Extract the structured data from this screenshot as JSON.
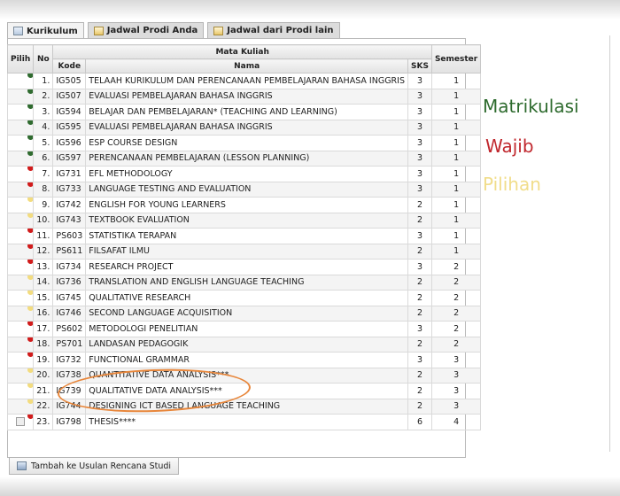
{
  "tabs": [
    {
      "label": "Kurikulum",
      "active": true
    },
    {
      "label": "Jadwal Prodi Anda",
      "active": false
    },
    {
      "label": "Jadwal dari Prodi lain",
      "active": false
    }
  ],
  "table": {
    "headers": {
      "pilih": "Pilih",
      "no": "No",
      "mata_kuliah": "Mata Kuliah",
      "kode": "Kode",
      "nama": "Nama",
      "sks": "SKS",
      "semester": "Semester"
    },
    "rows": [
      {
        "no": "1.",
        "kode": "IG505",
        "nama": "TELAAH KURIKULUM DAN PERENCANAAN PEMBELAJARAN BAHASA INGGRIS",
        "sks": "3",
        "semester": "1",
        "mark": "green"
      },
      {
        "no": "2.",
        "kode": "IG507",
        "nama": "EVALUASI PEMBELAJARAN BAHASA INGGRIS",
        "sks": "3",
        "semester": "1",
        "mark": "green"
      },
      {
        "no": "3.",
        "kode": "IG594",
        "nama": "BELAJAR DAN PEMBELAJARAN* (TEACHING AND LEARNING)",
        "sks": "3",
        "semester": "1",
        "mark": "green"
      },
      {
        "no": "4.",
        "kode": "IG595",
        "nama": "EVALUASI PEMBELAJARAN BAHASA INGGRIS",
        "sks": "3",
        "semester": "1",
        "mark": "green"
      },
      {
        "no": "5.",
        "kode": "IG596",
        "nama": "ESP COURSE DESIGN",
        "sks": "3",
        "semester": "1",
        "mark": "green"
      },
      {
        "no": "6.",
        "kode": "IG597",
        "nama": "PERENCANAAN PEMBELAJARAN (LESSON PLANNING)",
        "sks": "3",
        "semester": "1",
        "mark": "green"
      },
      {
        "no": "7.",
        "kode": "IG731",
        "nama": "EFL METHODOLOGY",
        "sks": "3",
        "semester": "1",
        "mark": "red"
      },
      {
        "no": "8.",
        "kode": "IG733",
        "nama": "LANGUAGE TESTING AND EVALUATION",
        "sks": "3",
        "semester": "1",
        "mark": "red"
      },
      {
        "no": "9.",
        "kode": "IG742",
        "nama": "ENGLISH FOR YOUNG LEARNERS",
        "sks": "2",
        "semester": "1",
        "mark": "yellow"
      },
      {
        "no": "10.",
        "kode": "IG743",
        "nama": "TEXTBOOK EVALUATION",
        "sks": "2",
        "semester": "1",
        "mark": "yellow"
      },
      {
        "no": "11.",
        "kode": "PS603",
        "nama": "STATISTIKA TERAPAN",
        "sks": "3",
        "semester": "1",
        "mark": "red"
      },
      {
        "no": "12.",
        "kode": "PS611",
        "nama": "FILSAFAT ILMU",
        "sks": "2",
        "semester": "1",
        "mark": "red"
      },
      {
        "no": "13.",
        "kode": "IG734",
        "nama": "RESEARCH PROJECT",
        "sks": "3",
        "semester": "2",
        "mark": "red"
      },
      {
        "no": "14.",
        "kode": "IG736",
        "nama": "TRANSLATION AND ENGLISH LANGUAGE TEACHING",
        "sks": "2",
        "semester": "2",
        "mark": "yellow"
      },
      {
        "no": "15.",
        "kode": "IG745",
        "nama": "QUALITATIVE RESEARCH",
        "sks": "2",
        "semester": "2",
        "mark": "yellow"
      },
      {
        "no": "16.",
        "kode": "IG746",
        "nama": "SECOND LANGUAGE ACQUISITION",
        "sks": "2",
        "semester": "2",
        "mark": "yellow"
      },
      {
        "no": "17.",
        "kode": "PS602",
        "nama": "METODOLOGI PENELITIAN",
        "sks": "3",
        "semester": "2",
        "mark": "red"
      },
      {
        "no": "18.",
        "kode": "PS701",
        "nama": "LANDASAN PEDAGOGIK",
        "sks": "2",
        "semester": "2",
        "mark": "red"
      },
      {
        "no": "19.",
        "kode": "IG732",
        "nama": "FUNCTIONAL GRAMMAR",
        "sks": "3",
        "semester": "3",
        "mark": "red"
      },
      {
        "no": "20.",
        "kode": "IG738",
        "nama": "QUANTITATIVE DATA ANALYSIS***",
        "sks": "2",
        "semester": "3",
        "mark": "yellow"
      },
      {
        "no": "21.",
        "kode": "IG739",
        "nama": "QUALITATIVE DATA ANALYSIS***",
        "sks": "2",
        "semester": "3",
        "mark": "yellow"
      },
      {
        "no": "22.",
        "kode": "IG744",
        "nama": "DESIGNING ICT BASED LANGUAGE TEACHING",
        "sks": "2",
        "semester": "3",
        "mark": "yellow"
      },
      {
        "no": "23.",
        "kode": "IG798",
        "nama": "THESIS****",
        "sks": "6",
        "semester": "4",
        "mark": "red"
      }
    ]
  },
  "add_button": "Tambah ke Usulan Rencana Studi",
  "legend": {
    "matrikulasi": "Matrikulasi",
    "wajib": "Wajib",
    "pilihan": "Pilihan"
  },
  "colors": {
    "green": "#2f6b2f",
    "red": "#d11b1b",
    "yellow": "#f3dc7e",
    "annotation": "#e8863a"
  }
}
